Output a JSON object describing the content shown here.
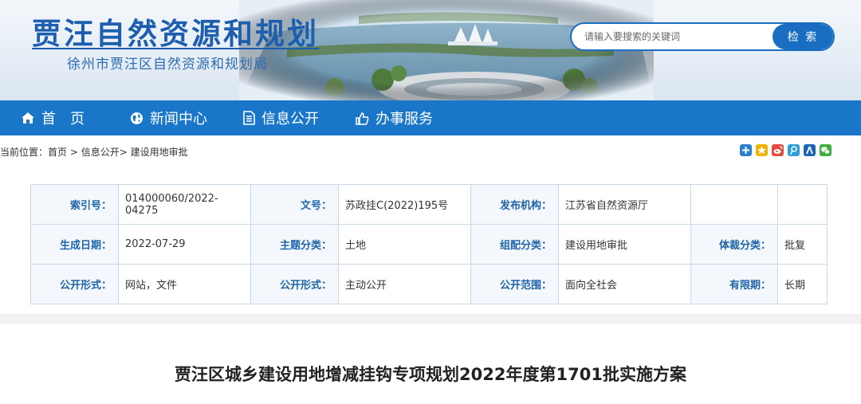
{
  "header": {
    "site_title": "贾汪自然资源和规划",
    "site_subtitle": "徐州市贾汪区自然资源和规划局"
  },
  "search": {
    "placeholder": "请输入要搜索的关键词",
    "button_label": "检 索"
  },
  "nav": {
    "items": [
      {
        "label": "首　页",
        "icon": "home-icon"
      },
      {
        "label": "新闻中心",
        "icon": "globe-icon"
      },
      {
        "label": "信息公开",
        "icon": "document-icon"
      },
      {
        "label": "办事服务",
        "icon": "thumbs-up-icon"
      }
    ]
  },
  "breadcrumb": {
    "prefix": "当前位置：",
    "items": [
      "首页",
      "信息公开",
      "建设用地审批"
    ],
    "separators": [
      " > ",
      "> "
    ]
  },
  "share_icons": [
    "plus-share-icon",
    "qzone-icon",
    "weibo-icon",
    "tencent-weibo-icon",
    "renren-icon",
    "wechat-icon"
  ],
  "info": {
    "rows": [
      [
        {
          "label": "索引号：",
          "value": "014000060/2022-04275"
        },
        {
          "label": "文号：",
          "value": "苏政挂C(2022)195号"
        },
        {
          "label": "发布机构：",
          "value": "江苏省自然资源厅"
        },
        {
          "label": "",
          "value": ""
        }
      ],
      [
        {
          "label": "生成日期：",
          "value": "2022-07-29"
        },
        {
          "label": "主题分类：",
          "value": "土地"
        },
        {
          "label": "组配分类：",
          "value": "建设用地审批"
        },
        {
          "label": "体裁分类：",
          "value": "批复"
        }
      ],
      [
        {
          "label": "公开形式：",
          "value": "网站，文件"
        },
        {
          "label": "公开形式：",
          "value": "主动公开"
        },
        {
          "label": "公开范围：",
          "value": "面向全社会"
        },
        {
          "label": "有限期：",
          "value": "长期"
        }
      ]
    ]
  },
  "article": {
    "title": "贾汪区城乡建设用地增减挂钩专项规划2022年度第1701批实施方案"
  },
  "colors": {
    "brand_blue": "#1a76c8",
    "title_blue": "#1d5fae",
    "label_blue": "#1f64a8"
  }
}
